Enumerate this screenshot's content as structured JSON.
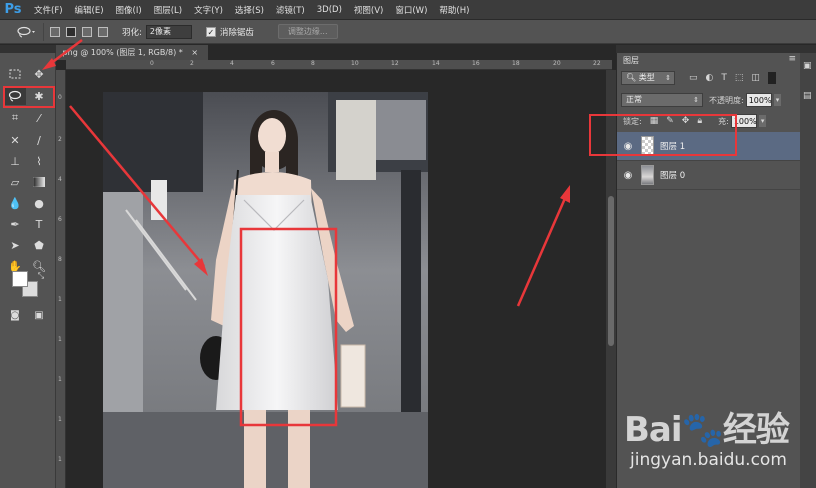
{
  "app": {
    "logo": "Ps"
  },
  "menu": [
    "文件(F)",
    "编辑(E)",
    "图像(I)",
    "图层(L)",
    "文字(Y)",
    "选择(S)",
    "滤镜(T)",
    "3D(D)",
    "视图(V)",
    "窗口(W)",
    "帮助(H)"
  ],
  "options": {
    "feather_label": "羽化:",
    "feather_value": "2像素",
    "antialias_label": "消除锯齿",
    "antialias_checked": true,
    "refine_edge_button": "调整边缘..."
  },
  "document": {
    "tab_title": ".png @ 100% (图层 1, RGB/8) *",
    "close_glyph": "×",
    "ruler_top": [
      "0",
      "2",
      "4",
      "6",
      "8",
      "10",
      "12",
      "14",
      "16",
      "18",
      "20",
      "22"
    ],
    "ruler_left": [
      "0",
      "2",
      "4",
      "6",
      "8",
      "1",
      "1",
      "1",
      "1",
      "1",
      "1"
    ]
  },
  "layers_panel": {
    "tab": "图层",
    "filter_kind": "类型",
    "blend_mode": "正常",
    "opacity_label": "不透明度:",
    "opacity_value": "100%",
    "lock_label": "锁定:",
    "fill_label": "充:",
    "fill_value": "100%",
    "layers": [
      {
        "name": "图层 1",
        "selected": true,
        "thumbnail": "transparent"
      },
      {
        "name": "图层 0",
        "selected": false,
        "thumbnail": "photo"
      }
    ]
  },
  "watermark": {
    "logo": "Bai🐾经验",
    "url": "jingyan.baidu.com"
  },
  "colors": {
    "annotation_red": "#e8373a",
    "selected_layer": "#5b6a83",
    "ps_blue": "#3d9ee8"
  }
}
